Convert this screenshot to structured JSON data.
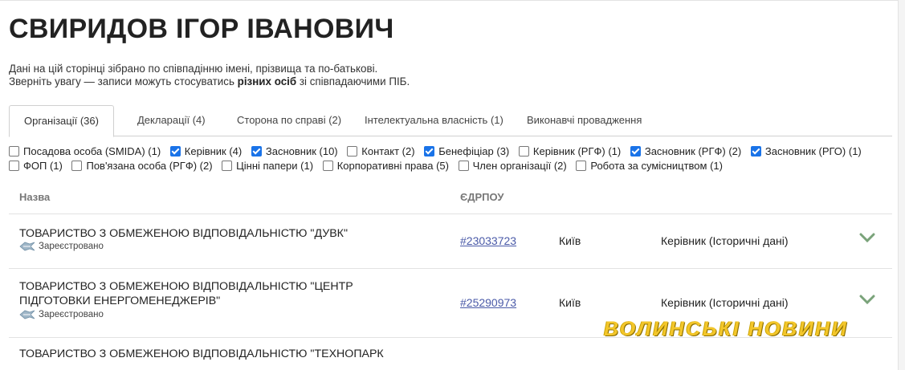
{
  "person": {
    "name": "СВИРИДОВ ІГОР ІВАНОВИЧ",
    "note_line1": "Дані на цій сторінці зібрано по співпадінню імені, прізвища та по-батькові.",
    "note_line2_pre": "Зверніть увагу — записи можуть стосуватись ",
    "note_line2_bold": "різних осіб",
    "note_line2_post": " зі співпадаючими ПІБ."
  },
  "tabs": [
    {
      "label": "Організації (36)",
      "active": true
    },
    {
      "label": "Декларації (4)",
      "active": false
    },
    {
      "label": "Сторона по справі (2)",
      "active": false
    },
    {
      "label": "Інтелектуальна власність (1)",
      "active": false
    },
    {
      "label": "Виконавчі провадження",
      "active": false
    }
  ],
  "filters": [
    {
      "label": "Посадова особа (SMIDA) (1)",
      "checked": false
    },
    {
      "label": "Керівник (4)",
      "checked": true
    },
    {
      "label": "Засновник (10)",
      "checked": true
    },
    {
      "label": "Контакт (2)",
      "checked": false
    },
    {
      "label": "Бенефіціар (3)",
      "checked": true
    },
    {
      "label": "Керівник (РГФ) (1)",
      "checked": false
    },
    {
      "label": "Засновник (РГФ) (2)",
      "checked": true
    },
    {
      "label": "Засновник (РГО) (1)",
      "checked": true
    },
    {
      "label": "ФОП (1)",
      "checked": false
    },
    {
      "label": "Пов'язана особа (РГФ) (2)",
      "checked": false
    },
    {
      "label": "Цінні папери (1)",
      "checked": false
    },
    {
      "label": "Корпоративні права (5)",
      "checked": false
    },
    {
      "label": "Член організації (2)",
      "checked": false
    },
    {
      "label": "Робота за сумісництвом (1)",
      "checked": false
    }
  ],
  "table": {
    "col_name": "Назва",
    "col_code": "ЄДРПОУ",
    "rows": [
      {
        "name": "ТОВАРИСТВО З ОБМЕЖЕНОЮ ВІДПОВІДАЛЬНІСТЮ \"ДУВК\"",
        "status": "Зареєстровано",
        "code": "#23033723",
        "city": "Київ",
        "role": "Керівник (Історичні дані)"
      },
      {
        "name": "ТОВАРИСТВО З ОБМЕЖЕНОЮ ВІДПОВІДАЛЬНІСТЮ \"ЦЕНТР ПІДГОТОВКИ ЕНЕРГОМЕНЕДЖЕРІВ\"",
        "status": "Зареєстровано",
        "code": "#25290973",
        "city": "Київ",
        "role": "Керівник (Історичні дані)"
      },
      {
        "name": "ТОВАРИСТВО З ОБМЕЖЕНОЮ ВІДПОВІДАЛЬНІСТЮ \"ТЕХНОПАРК"
      }
    ]
  },
  "watermark": "ВОЛИНСЬКІ НОВИНИ",
  "colors": {
    "checkbox_checked": "#1a73e8",
    "link": "#4a5aa8",
    "chevron": "#7aa37a",
    "watermark": "#f3c62a"
  },
  "icons": {
    "status": "registered-stamp-icon",
    "expand": "chevron-down-icon"
  }
}
